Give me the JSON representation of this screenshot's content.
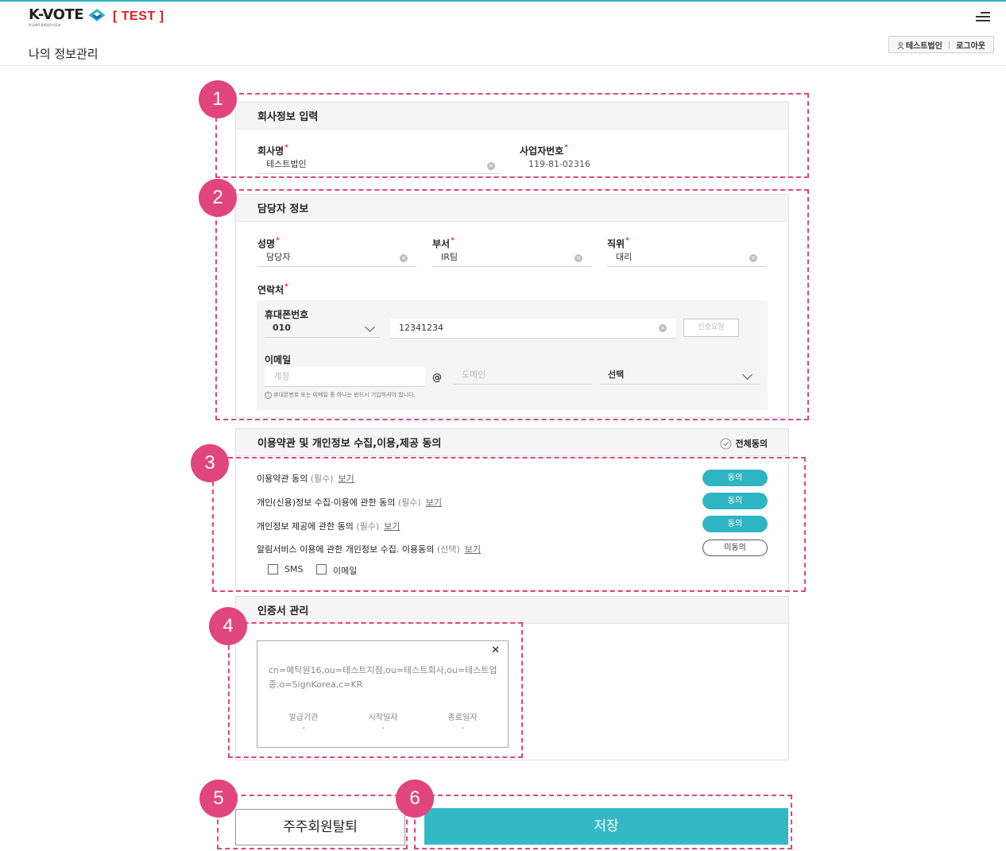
{
  "header": {
    "logo_text": "K-VOTE",
    "logo_sub": "한국예탁결제원전자투표",
    "test_tag": "[ TEST ]",
    "page_title": "나의 정보관리",
    "user_name": "테스트법인",
    "logout": "로그아웃",
    "separator": "|"
  },
  "company": {
    "title": "회사정보 입력",
    "name_label": "회사명",
    "name_value": "테스트법인",
    "bizno_label": "사업자번호",
    "bizno_value": "119-81-02316"
  },
  "manager": {
    "title": "담당자 정보",
    "name_label": "성명",
    "name_value": "담당자",
    "dept_label": "부서",
    "dept_value": "IR팀",
    "position_label": "직위",
    "position_value": "대리",
    "contact_label": "연락처",
    "phone_label": "휴대폰번호",
    "phone_prefix": "010",
    "phone_number": "12341234",
    "verify_button": "인증요청",
    "email_label": "이메일",
    "email_account_placeholder": "계정",
    "at": "@",
    "email_domain_placeholder": "도메인",
    "email_select": "선택",
    "notice": "휴대폰번호 또는 이메일 중 하나는 반드시 기입하셔야 합니다."
  },
  "terms": {
    "title": "이용약관 및 개인정보 수집,이용,제공 동의",
    "agree_all": "전체동의",
    "view": "보기",
    "items": [
      {
        "label": "이용약관 동의",
        "tag": "(필수)",
        "status": "동의"
      },
      {
        "label": "개인(신용)정보 수집·이용에 관한 동의",
        "tag": "(필수)",
        "status": "동의"
      },
      {
        "label": "개인정보 제공에 관한 동의",
        "tag": "(필수)",
        "status": "동의"
      },
      {
        "label": "알림서비스 이용에 관한 개인정보 수집. 이용동의",
        "tag": "(선택)",
        "status": "미동의"
      }
    ],
    "sms_label": "SMS",
    "email_label": "이메일"
  },
  "certificate": {
    "title": "인증서 관리",
    "dn": "cn=예탁원16,ou=테스트지점,ou=테스트회사,ou=테스트업종,o=SignKorea,c=KR",
    "issuer_label": "발급기관",
    "start_label": "시작일자",
    "end_label": "종료일자",
    "issuer_value": "-",
    "start_value": "-",
    "end_value": "-",
    "close": "✕"
  },
  "actions": {
    "withdraw": "주주회원탈퇴",
    "save": "저장"
  },
  "annotations": [
    "1",
    "2",
    "3",
    "4",
    "5",
    "6"
  ],
  "colors": {
    "accent": "#2fb5c2",
    "annotation": "#e0457c",
    "test_tag": "#e02020"
  }
}
